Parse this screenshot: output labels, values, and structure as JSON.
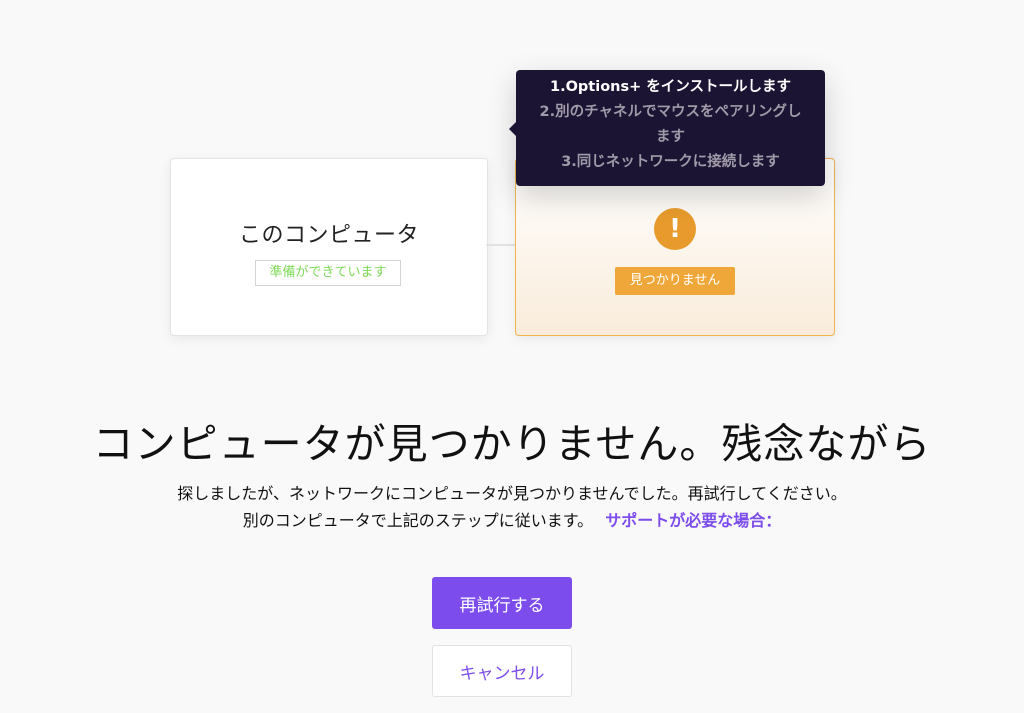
{
  "computer_card": {
    "title": "このコンピュータ",
    "status": "準備ができています"
  },
  "target_card": {
    "alert_glyph": "!",
    "status": "見つかりません",
    "icon": "exclamation-icon"
  },
  "tooltip": {
    "step_1": "1.Options+ をインストールします",
    "step_2": "2.別のチャネルでマウスをペアリングします",
    "step_3": "3.同じネットワークに接続します"
  },
  "main": {
    "heading": "コンピュータが見つかりません。残念ながら",
    "description_1": "探しましたが、ネットワークにコンピュータが見つかりませんでした。再試行してください。",
    "description_2": "別のコンピュータで上記のステップに従います。",
    "support_link": "サポートが必要な場合："
  },
  "buttons": {
    "retry": "再試行する",
    "cancel": "キャンセル"
  },
  "colors": {
    "accent": "#7c4dec",
    "ready_green": "#7ed957",
    "warning_orange": "#f0a73a",
    "tooltip_bg": "#1b1433"
  }
}
